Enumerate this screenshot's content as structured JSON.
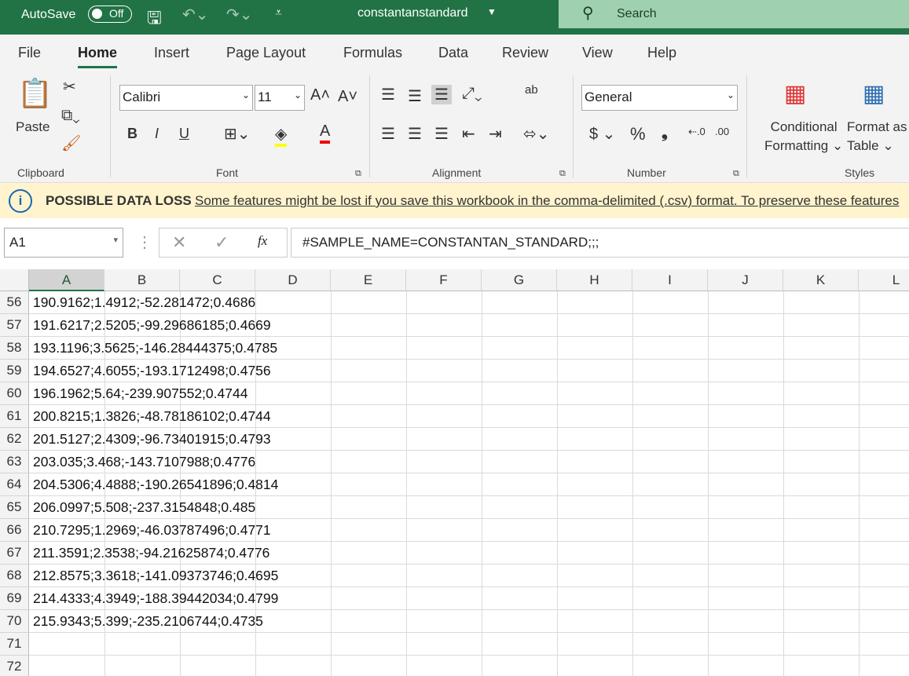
{
  "titlebar": {
    "autosave": "AutoSave",
    "toggle": "Off",
    "filename": "constantanstandard",
    "search": "Search"
  },
  "tabs": [
    "File",
    "Home",
    "Insert",
    "Page Layout",
    "Formulas",
    "Data",
    "Review",
    "View",
    "Help"
  ],
  "ribbon": {
    "paste": "Paste",
    "clipboard": "Clipboard",
    "font_name": "Calibri",
    "font_size": "11",
    "font": "Font",
    "alignment": "Alignment",
    "number_format": "General",
    "number": "Number",
    "conditional1": "Conditional",
    "conditional2": "Formatting",
    "format_as1": "Format as",
    "format_as2": "Table",
    "styles": "Styles",
    "bold": "B",
    "italic": "I",
    "underline": "U",
    "ab": "ab"
  },
  "infobar": {
    "title": "POSSIBLE DATA LOSS",
    "message": "Some features might be lost if you save this workbook in the comma-delimited (.csv) format. To preserve these features"
  },
  "formula": {
    "namebox": "A1",
    "fx": "fx",
    "content": "#SAMPLE_NAME=CONSTANTAN_STANDARD;;;"
  },
  "columns": [
    "A",
    "B",
    "C",
    "D",
    "E",
    "F",
    "G",
    "H",
    "I",
    "J",
    "K",
    "L"
  ],
  "rows": [
    {
      "n": "56",
      "a": "190.9162;1.4912;-52.281472;0.4686"
    },
    {
      "n": "57",
      "a": "191.6217;2.5205;-99.29686185;0.4669"
    },
    {
      "n": "58",
      "a": "193.1196;3.5625;-146.28444375;0.4785"
    },
    {
      "n": "59",
      "a": "194.6527;4.6055;-193.1712498;0.4756"
    },
    {
      "n": "60",
      "a": "196.1962;5.64;-239.907552;0.4744"
    },
    {
      "n": "61",
      "a": "200.8215;1.3826;-48.78186102;0.4744"
    },
    {
      "n": "62",
      "a": "201.5127;2.4309;-96.73401915;0.4793"
    },
    {
      "n": "63",
      "a": "203.035;3.468;-143.7107988;0.4776"
    },
    {
      "n": "64",
      "a": "204.5306;4.4888;-190.26541896;0.4814"
    },
    {
      "n": "65",
      "a": "206.0997;5.508;-237.3154848;0.485"
    },
    {
      "n": "66",
      "a": "210.7295;1.2969;-46.03787496;0.4771"
    },
    {
      "n": "67",
      "a": "211.3591;2.3538;-94.21625874;0.4776"
    },
    {
      "n": "68",
      "a": "212.8575;3.3618;-141.09373746;0.4695"
    },
    {
      "n": "69",
      "a": "214.4333;4.3949;-188.39442034;0.4799"
    },
    {
      "n": "70",
      "a": "215.9343;5.399;-235.2106744;0.4735"
    },
    {
      "n": "71",
      "a": ""
    },
    {
      "n": "72",
      "a": ""
    }
  ],
  "colors": {
    "brand": "#217346",
    "infobar": "#fff4ce"
  }
}
